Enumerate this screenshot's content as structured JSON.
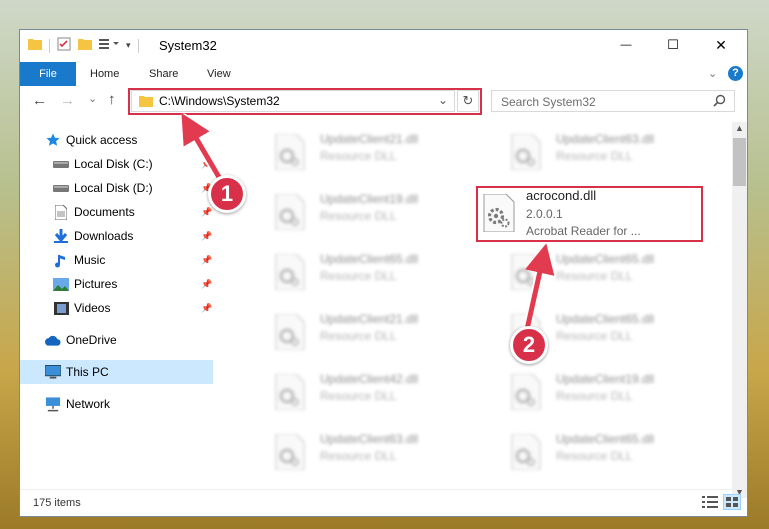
{
  "window": {
    "title": "System32",
    "controls": {
      "minimize": "—",
      "maximize": "☐",
      "close": "✕"
    },
    "help": "?"
  },
  "ribbon": {
    "tabs": [
      "File",
      "Home",
      "Share",
      "View"
    ],
    "expand": "⌄"
  },
  "nav": {
    "back": "←",
    "forward": "→",
    "recent": "⌄",
    "up": "↑",
    "address": "C:\\Windows\\System32",
    "address_dropdown": "⌄",
    "refresh": "↻",
    "search_placeholder": "Search System32"
  },
  "sidebar": {
    "items": [
      {
        "label": "Quick access",
        "icon": "star-icon",
        "pinned": false
      },
      {
        "label": "Local Disk (C:)",
        "icon": "disk-icon",
        "pinned": true
      },
      {
        "label": "Local Disk (D:)",
        "icon": "disk-icon",
        "pinned": true
      },
      {
        "label": "Documents",
        "icon": "documents-icon",
        "pinned": true
      },
      {
        "label": "Downloads",
        "icon": "download-icon",
        "pinned": true
      },
      {
        "label": "Music",
        "icon": "music-icon",
        "pinned": true
      },
      {
        "label": "Pictures",
        "icon": "pictures-icon",
        "pinned": true
      },
      {
        "label": "Videos",
        "icon": "videos-icon",
        "pinned": true
      },
      {
        "label": "OneDrive",
        "icon": "cloud-icon",
        "pinned": false
      },
      {
        "label": "This PC",
        "icon": "computer-icon",
        "pinned": false,
        "selected": true
      },
      {
        "label": "Network",
        "icon": "network-icon",
        "pinned": false
      }
    ]
  },
  "files": {
    "left_column": [
      {
        "name": "UpdateClient21.dll",
        "type": "Resource DLL"
      },
      {
        "name": "UpdateClient19.dll",
        "type": "Resource DLL"
      },
      {
        "name": "UpdateClient65.dll",
        "type": "Resource DLL"
      },
      {
        "name": "UpdateClient21.dll",
        "type": "Resource DLL"
      },
      {
        "name": "UpdateClient42.dll",
        "type": "Resource DLL"
      },
      {
        "name": "UpdateClient63.dll",
        "type": "Resource DLL"
      }
    ],
    "right_column": [
      {
        "name": "UpdateClient63.dll",
        "type": "Resource DLL"
      },
      {
        "name": "acrocond.dll",
        "version": "2.0.0.1",
        "description": "Acrobat Reader for ...",
        "highlighted": true
      },
      {
        "name": "UpdateClient65.dll",
        "type": "Resource DLL"
      },
      {
        "name": "UpdateClient65.dll",
        "type": "Resource DLL"
      },
      {
        "name": "UpdateClient19.dll",
        "type": "Resource DLL"
      },
      {
        "name": "UpdateClient65.dll",
        "type": "Resource DLL"
      }
    ]
  },
  "status": {
    "item_count": "175 items"
  },
  "callouts": {
    "first": "1",
    "second": "2"
  },
  "colors": {
    "accent": "#1979ca",
    "highlight_red": "#d9304a",
    "selection": "#cce8ff"
  }
}
